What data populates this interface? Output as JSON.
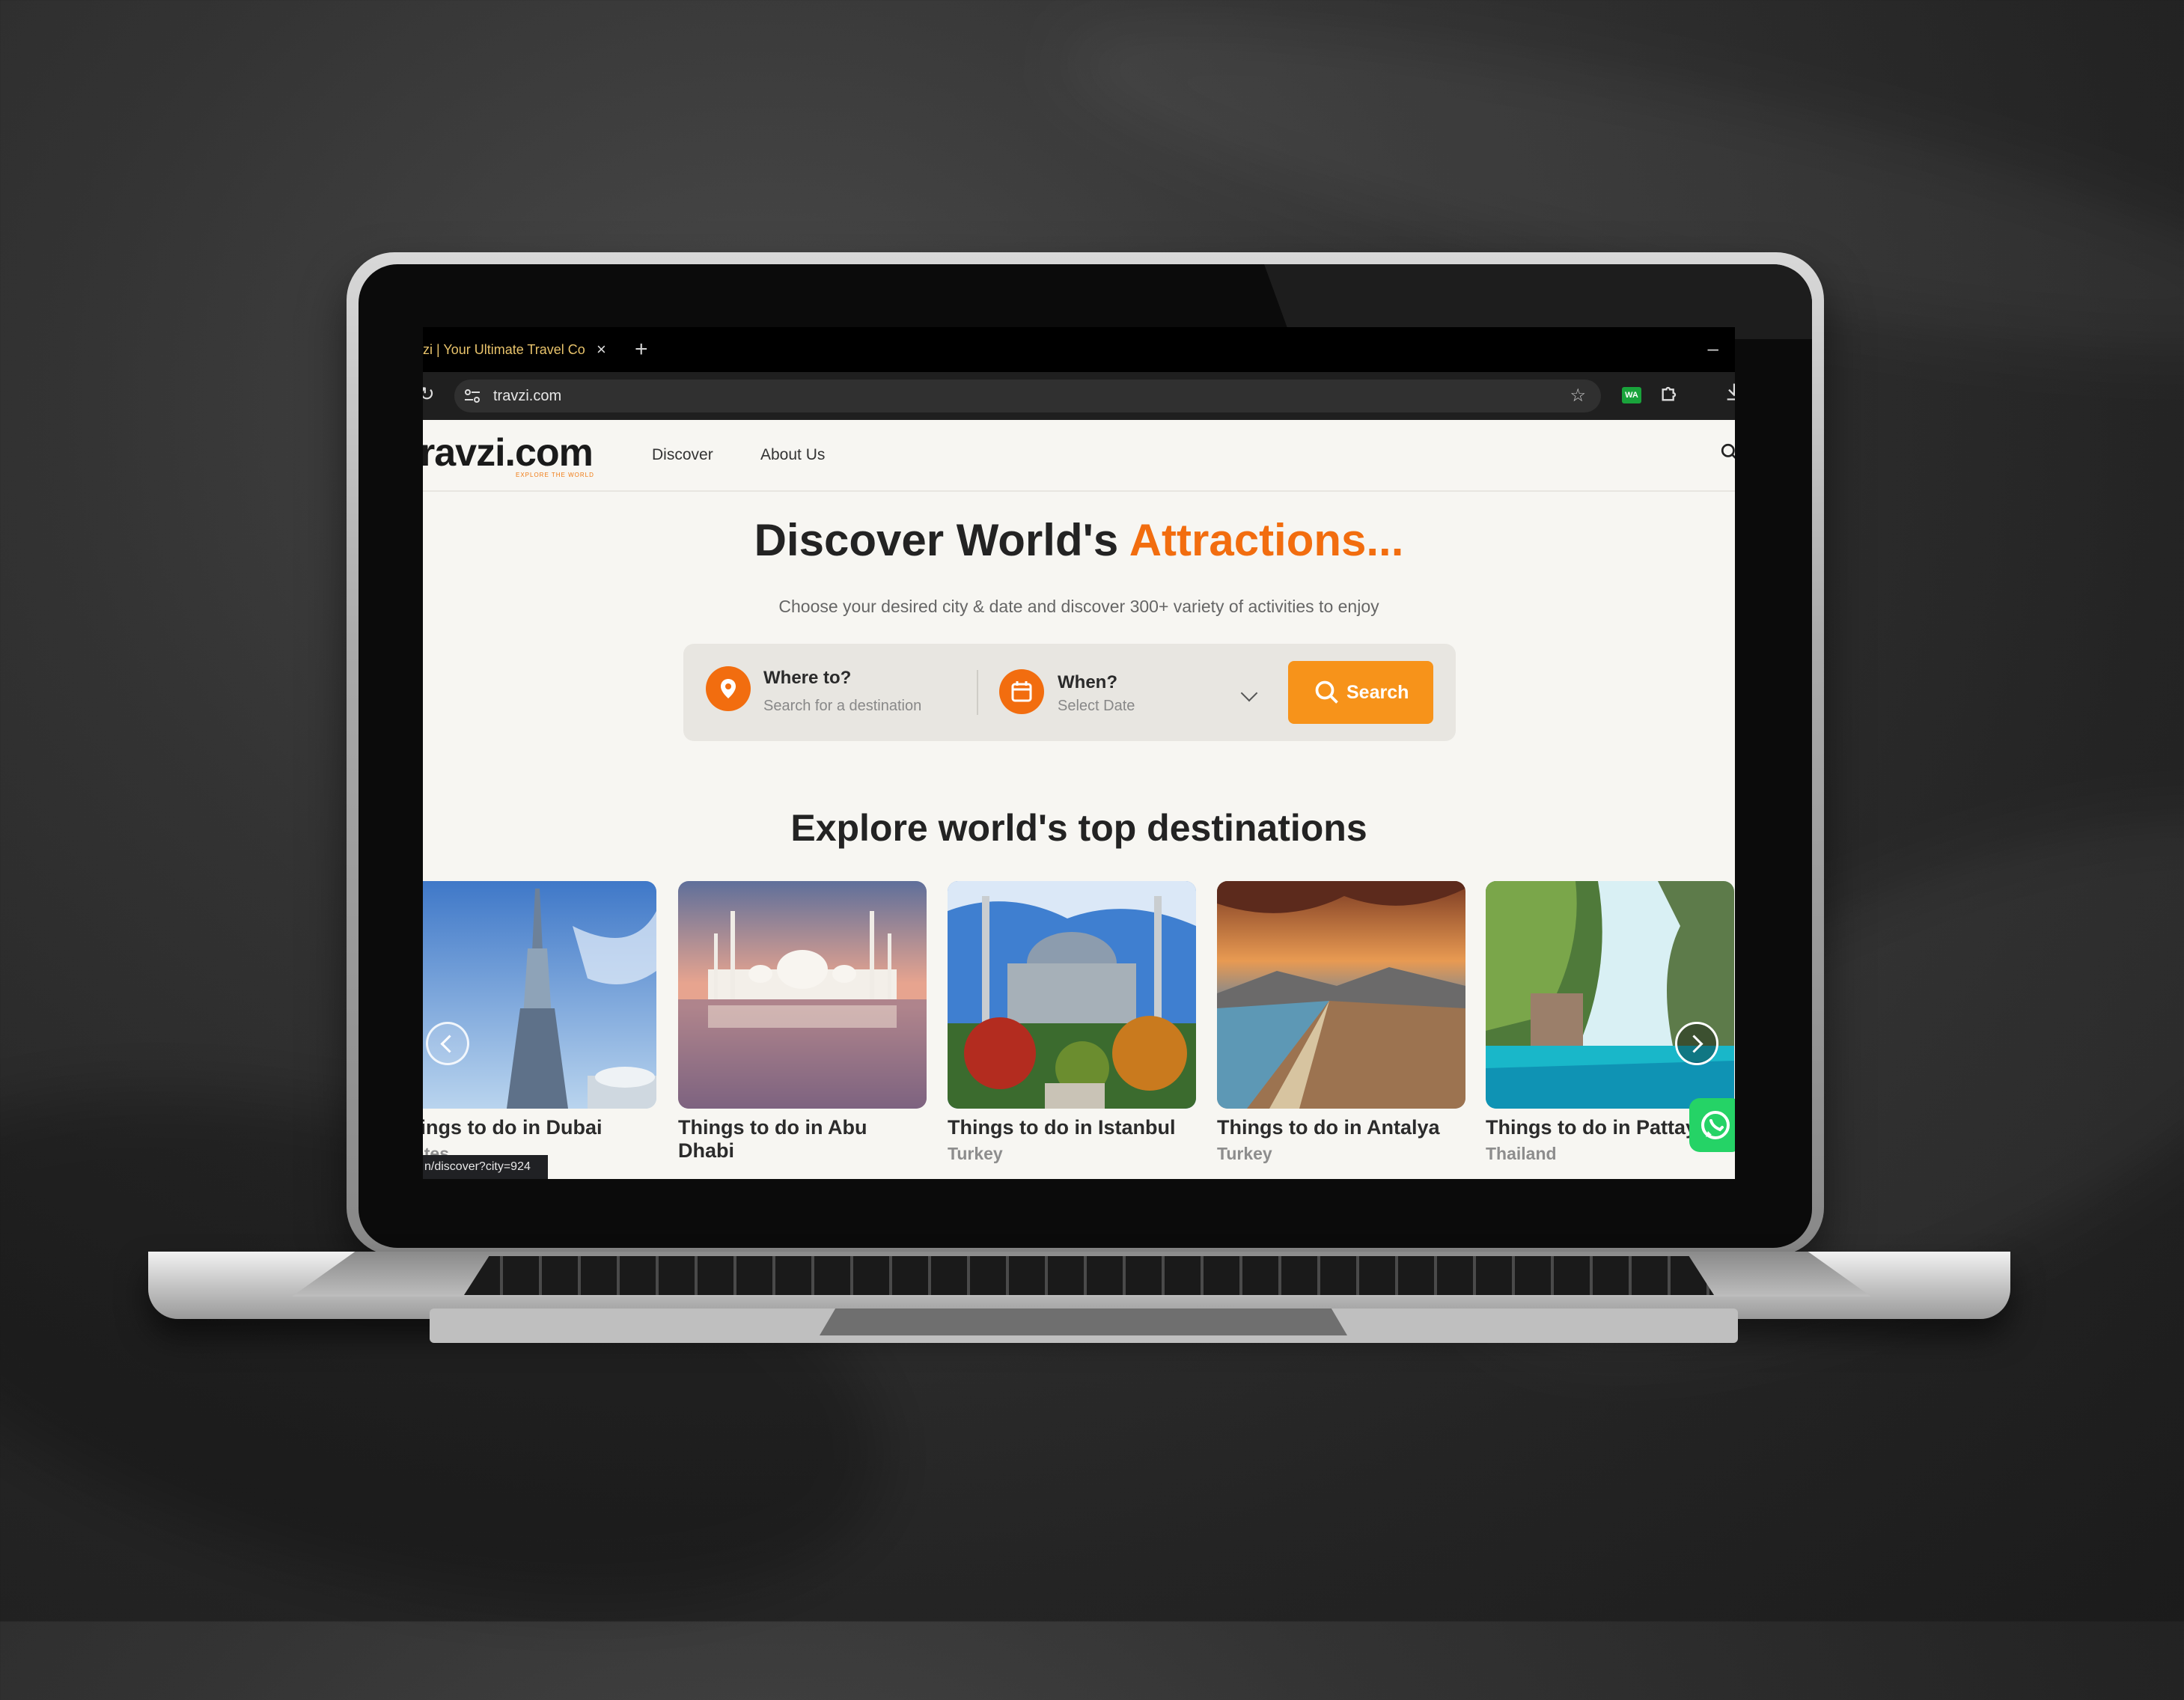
{
  "browser": {
    "tab_title": "zi | Your Ultimate Travel Co",
    "tab_close": "×",
    "new_tab": "+",
    "minimize": "–",
    "reload_glyph": "↻",
    "url": "travzi.com",
    "bookmark_glyph": "☆",
    "extension_badge": "WA",
    "status_url": "n/discover?city=924"
  },
  "nav": {
    "logo_text": "ravzi.com",
    "logo_tagline": "EXPLORE THE WORLD",
    "links": [
      "Discover",
      "About Us"
    ]
  },
  "hero": {
    "title_main": "Discover World's",
    "title_accent": "Attractions...",
    "subtitle": "Choose your desired city & date and discover 300+ variety of activities to enjoy"
  },
  "search": {
    "where_label": "Where to?",
    "where_placeholder": "Search for a destination",
    "when_label": "When?",
    "when_placeholder": "Select Date",
    "button_label": "Search"
  },
  "destinations": {
    "title": "Explore world's top destinations",
    "cards": [
      {
        "caption": "hings to do in Dubai",
        "country": "rates",
        "image": "dubai-burj-khalifa"
      },
      {
        "caption": "Things to do in Abu Dhabi",
        "country": "",
        "image": "abu-dhabi-grand-mosque"
      },
      {
        "caption": "Things to do in Istanbul",
        "country": "Turkey",
        "image": "istanbul-blue-mosque"
      },
      {
        "caption": "Things to do in Antalya",
        "country": "Turkey",
        "image": "antalya-coast"
      },
      {
        "caption": "Things to do in Pattay",
        "country": "Thailand",
        "image": "pattaya-lagoon"
      }
    ]
  },
  "icons": [
    "location-pin-icon",
    "calendar-icon",
    "search-icon",
    "whatsapp-icon",
    "chevron-left-icon",
    "chevron-right-icon",
    "puzzle-icon",
    "download-icon",
    "star-icon"
  ],
  "colors": {
    "accent": "#f26d0f",
    "button": "#f7931a",
    "whatsapp": "#25d366"
  }
}
